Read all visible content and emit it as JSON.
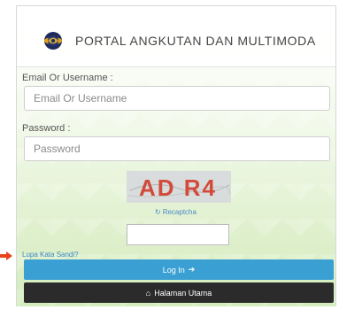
{
  "header": {
    "title": "PORTAL ANGKUTAN DAN MULTIMODA",
    "logo_icon": "globe-logo-icon"
  },
  "form": {
    "email_label": "Email Or Username :",
    "email_placeholder": "Email Or Username",
    "password_label": "Password :",
    "password_placeholder": "Password",
    "captcha_text": "AD R4",
    "recaptcha_link": "Recaptcha",
    "forgot_link": "Lupa Kata Sandi?",
    "login_button": "Log In",
    "home_button": "Halaman Utama"
  },
  "colors": {
    "login_button": "#3aa0d3",
    "home_button": "#2b2b2b",
    "link": "#3a87c9",
    "captcha_text": "#d24a3a",
    "pointer_arrow": "#e8441c"
  }
}
